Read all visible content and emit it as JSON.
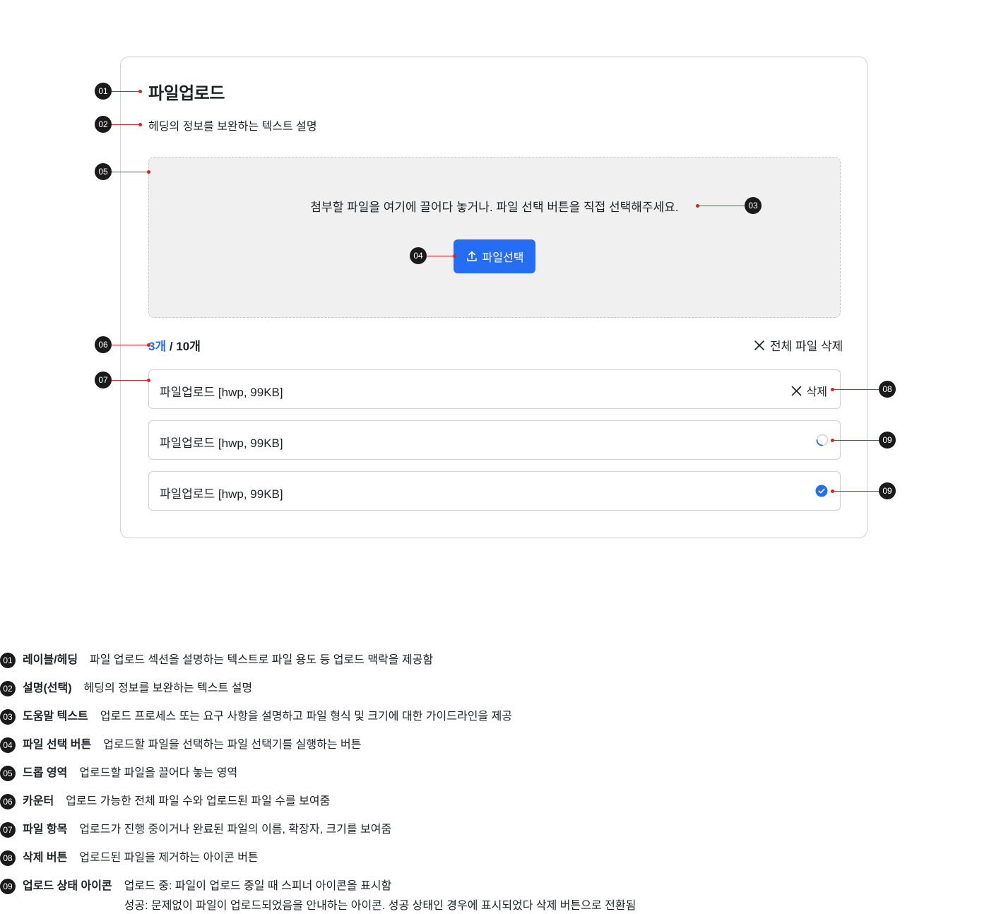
{
  "component": {
    "heading": "파일업로드",
    "description": "헤딩의 정보를 보완하는 텍스트 설명",
    "help_text": "첨부할 파일을 여기에 끌어다 놓거나. 파일 선택 버튼을 직접 선택해주세요.",
    "upload_button_label": "파일선택",
    "counter_current": "3개",
    "counter_rest": " / 10개",
    "delete_all_label": "전체 파일 삭제",
    "files": [
      {
        "name": "파일업로드 [hwp, 99KB]",
        "status": "delete",
        "delete_label": "삭제"
      },
      {
        "name": "파일업로드 [hwp, 99KB]",
        "status": "uploading"
      },
      {
        "name": "파일업로드 [hwp, 99KB]",
        "status": "success"
      }
    ],
    "accent_color": "#256ef4",
    "icons": [
      "upload-icon",
      "close-icon",
      "spinner-icon",
      "check-circle-icon"
    ]
  },
  "callouts": [
    "01",
    "02",
    "03",
    "04",
    "05",
    "06",
    "07",
    "08",
    "09",
    "09"
  ],
  "legend": [
    {
      "num": "01",
      "term": "레이블/헤딩",
      "text": "파일 업로드 섹션을 설명하는 텍스트로 파일 용도 등 업로드 맥락을 제공함"
    },
    {
      "num": "02",
      "term": "설명(선택)",
      "text": "헤딩의 정보를 보완하는 텍스트 설명"
    },
    {
      "num": "03",
      "term": "도움말 텍스트",
      "text": "업로드 프로세스 또는 요구 사항을 설명하고 파일 형식 및 크기에 대한 가이드라인을 제공"
    },
    {
      "num": "04",
      "term": "파일 선택 버튼",
      "text": "업로드할 파일을 선택하는 파일 선택기를 실행하는 버튼"
    },
    {
      "num": "05",
      "term": "드롭 영역",
      "text": "업로드할 파일을 끌어다 놓는 영역"
    },
    {
      "num": "06",
      "term": "카운터",
      "text": "업로드 가능한 전체 파일 수와 업로드된 파일 수를 보여줌"
    },
    {
      "num": "07",
      "term": "파일 항목",
      "text": "업로드가 진행 중이거나 완료된 파일의 이름, 확장자, 크기를 보여줌"
    },
    {
      "num": "08",
      "term": "삭제 버튼",
      "text": "업로드된 파일을 제거하는 아이콘 버튼"
    },
    {
      "num": "09",
      "term": "업로드 상태 아이콘",
      "text": "업로드 중: 파일이 업로드 중일 때 스피너 아이콘을 표시함",
      "text2": "성공: 문제없이 파일이 업로드되었음을 안내하는 아이콘. 성공 상태인 경우에 표시되었다 삭제 버튼으로 전환됨"
    }
  ]
}
